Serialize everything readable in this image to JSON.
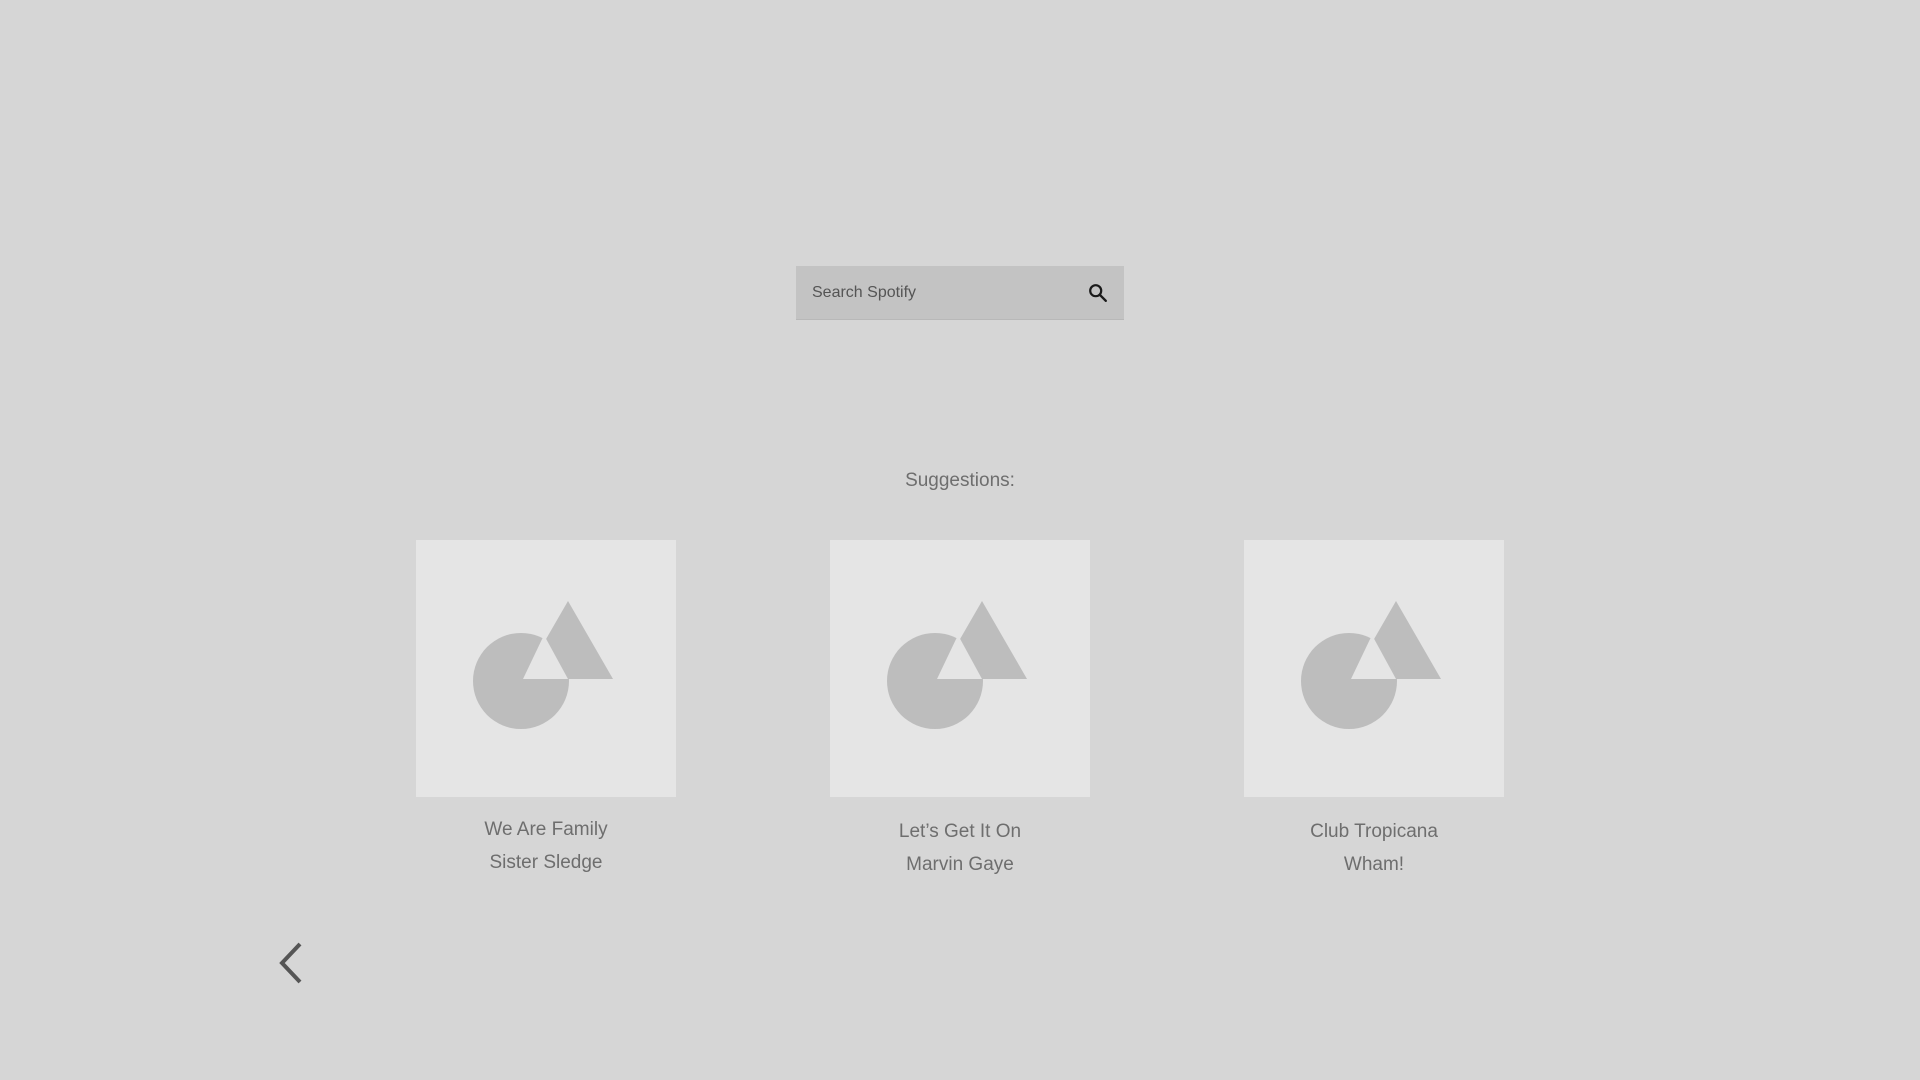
{
  "search": {
    "placeholder": "Search Spotify",
    "icon": "search-icon"
  },
  "suggestions": {
    "label": "Suggestions:",
    "items": [
      {
        "title": "We Are Family",
        "artist": "Sister Sledge",
        "art_icon": "image-placeholder-icon"
      },
      {
        "title": "Let’s Get It On",
        "artist": "Marvin Gaye",
        "art_icon": "image-placeholder-icon"
      },
      {
        "title": "Club Tropicana",
        "artist": "Wham!",
        "art_icon": "image-placeholder-icon"
      }
    ]
  },
  "navigation": {
    "back_icon": "chevron-left-icon"
  },
  "colors": {
    "background": "#d6d6d6",
    "search_field": "#c3c3c3",
    "card_background": "#e5e5e5",
    "placeholder_shape": "#bdbdbd",
    "text": "#6e6e6e",
    "icon": "#555555"
  }
}
